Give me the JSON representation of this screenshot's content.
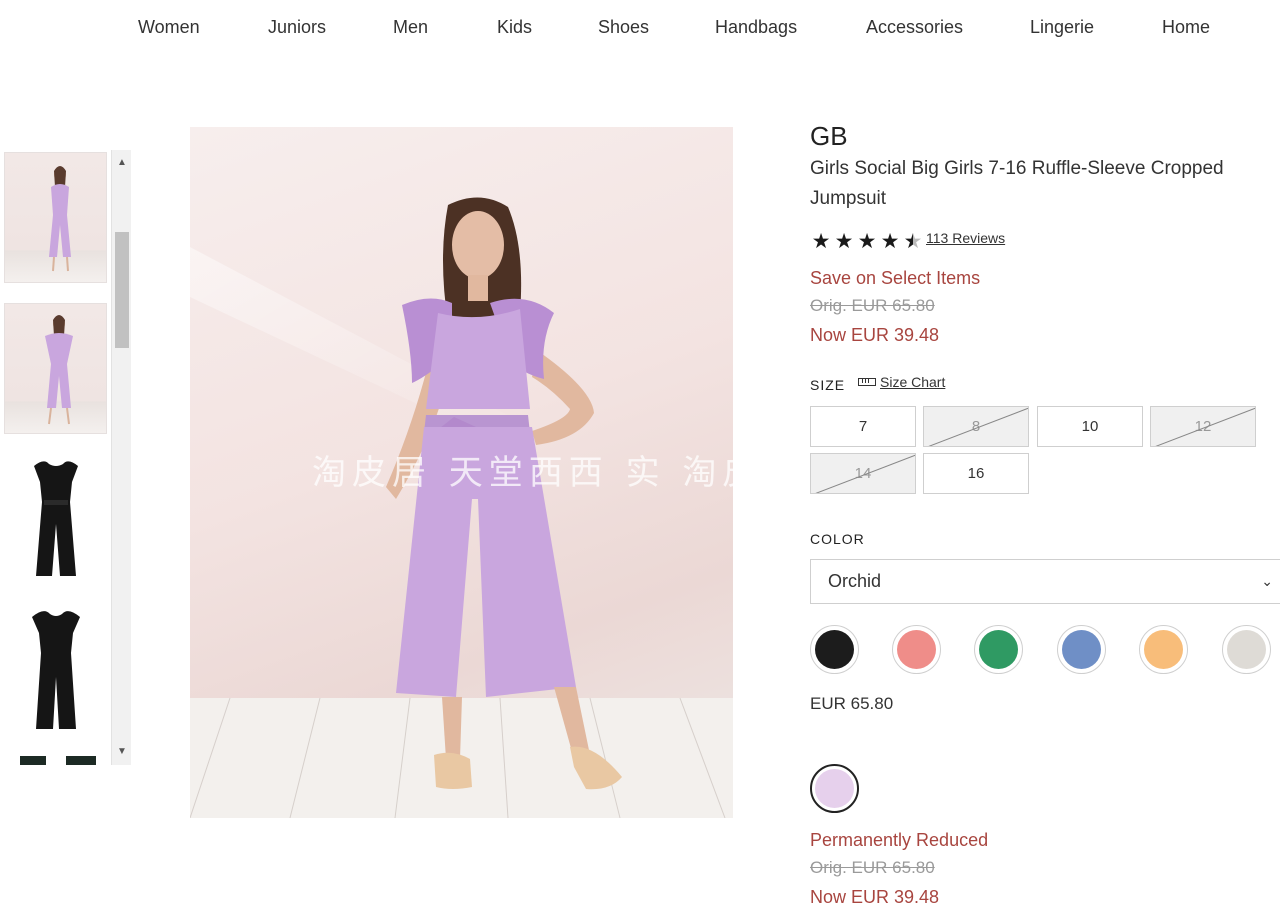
{
  "nav": {
    "items": [
      "Women",
      "Juniors",
      "Men",
      "Kids",
      "Shoes",
      "Handbags",
      "Accessories",
      "Lingerie",
      "Home"
    ]
  },
  "gallery": {
    "watermark": "淘皮居 天堂西西 实 淘皮"
  },
  "product": {
    "brand": "GB",
    "title": "Girls Social Big Girls 7-16 Ruffle-Sleeve Cropped Jumpsuit",
    "rating": 4.5,
    "rating_max": 5,
    "reviews": "113 Reviews",
    "promo": "Save on Select Items",
    "orig_price": "Orig. EUR 65.80",
    "now_price": "Now EUR 39.48"
  },
  "size": {
    "label": "SIZE",
    "chart_label": "Size Chart",
    "options": [
      {
        "label": "7",
        "available": true
      },
      {
        "label": "8",
        "available": false
      },
      {
        "label": "10",
        "available": true
      },
      {
        "label": "12",
        "available": false
      },
      {
        "label": "14",
        "available": false
      },
      {
        "label": "16",
        "available": true
      }
    ]
  },
  "color": {
    "label": "COLOR",
    "selected": "Orchid",
    "swatches": [
      {
        "name": "black",
        "hex": "#1c1c1c"
      },
      {
        "name": "coral",
        "hex": "#ef8d89"
      },
      {
        "name": "green",
        "hex": "#2f9a63"
      },
      {
        "name": "blue",
        "hex": "#6f8fc6"
      },
      {
        "name": "apricot",
        "hex": "#f8bd7a"
      },
      {
        "name": "light-gray",
        "hex": "#dedbd6"
      }
    ],
    "swatch_price": "EUR 65.80",
    "selected_swatch": {
      "name": "orchid",
      "hex": "#e6d0ec"
    },
    "selected_promo": "Permanently Reduced",
    "selected_orig_price": "Orig. EUR 65.80",
    "selected_now_price": "Now EUR 39.48"
  },
  "colors": {
    "sale_red": "#a8453f",
    "jumpsuit": "#c9a6de"
  }
}
